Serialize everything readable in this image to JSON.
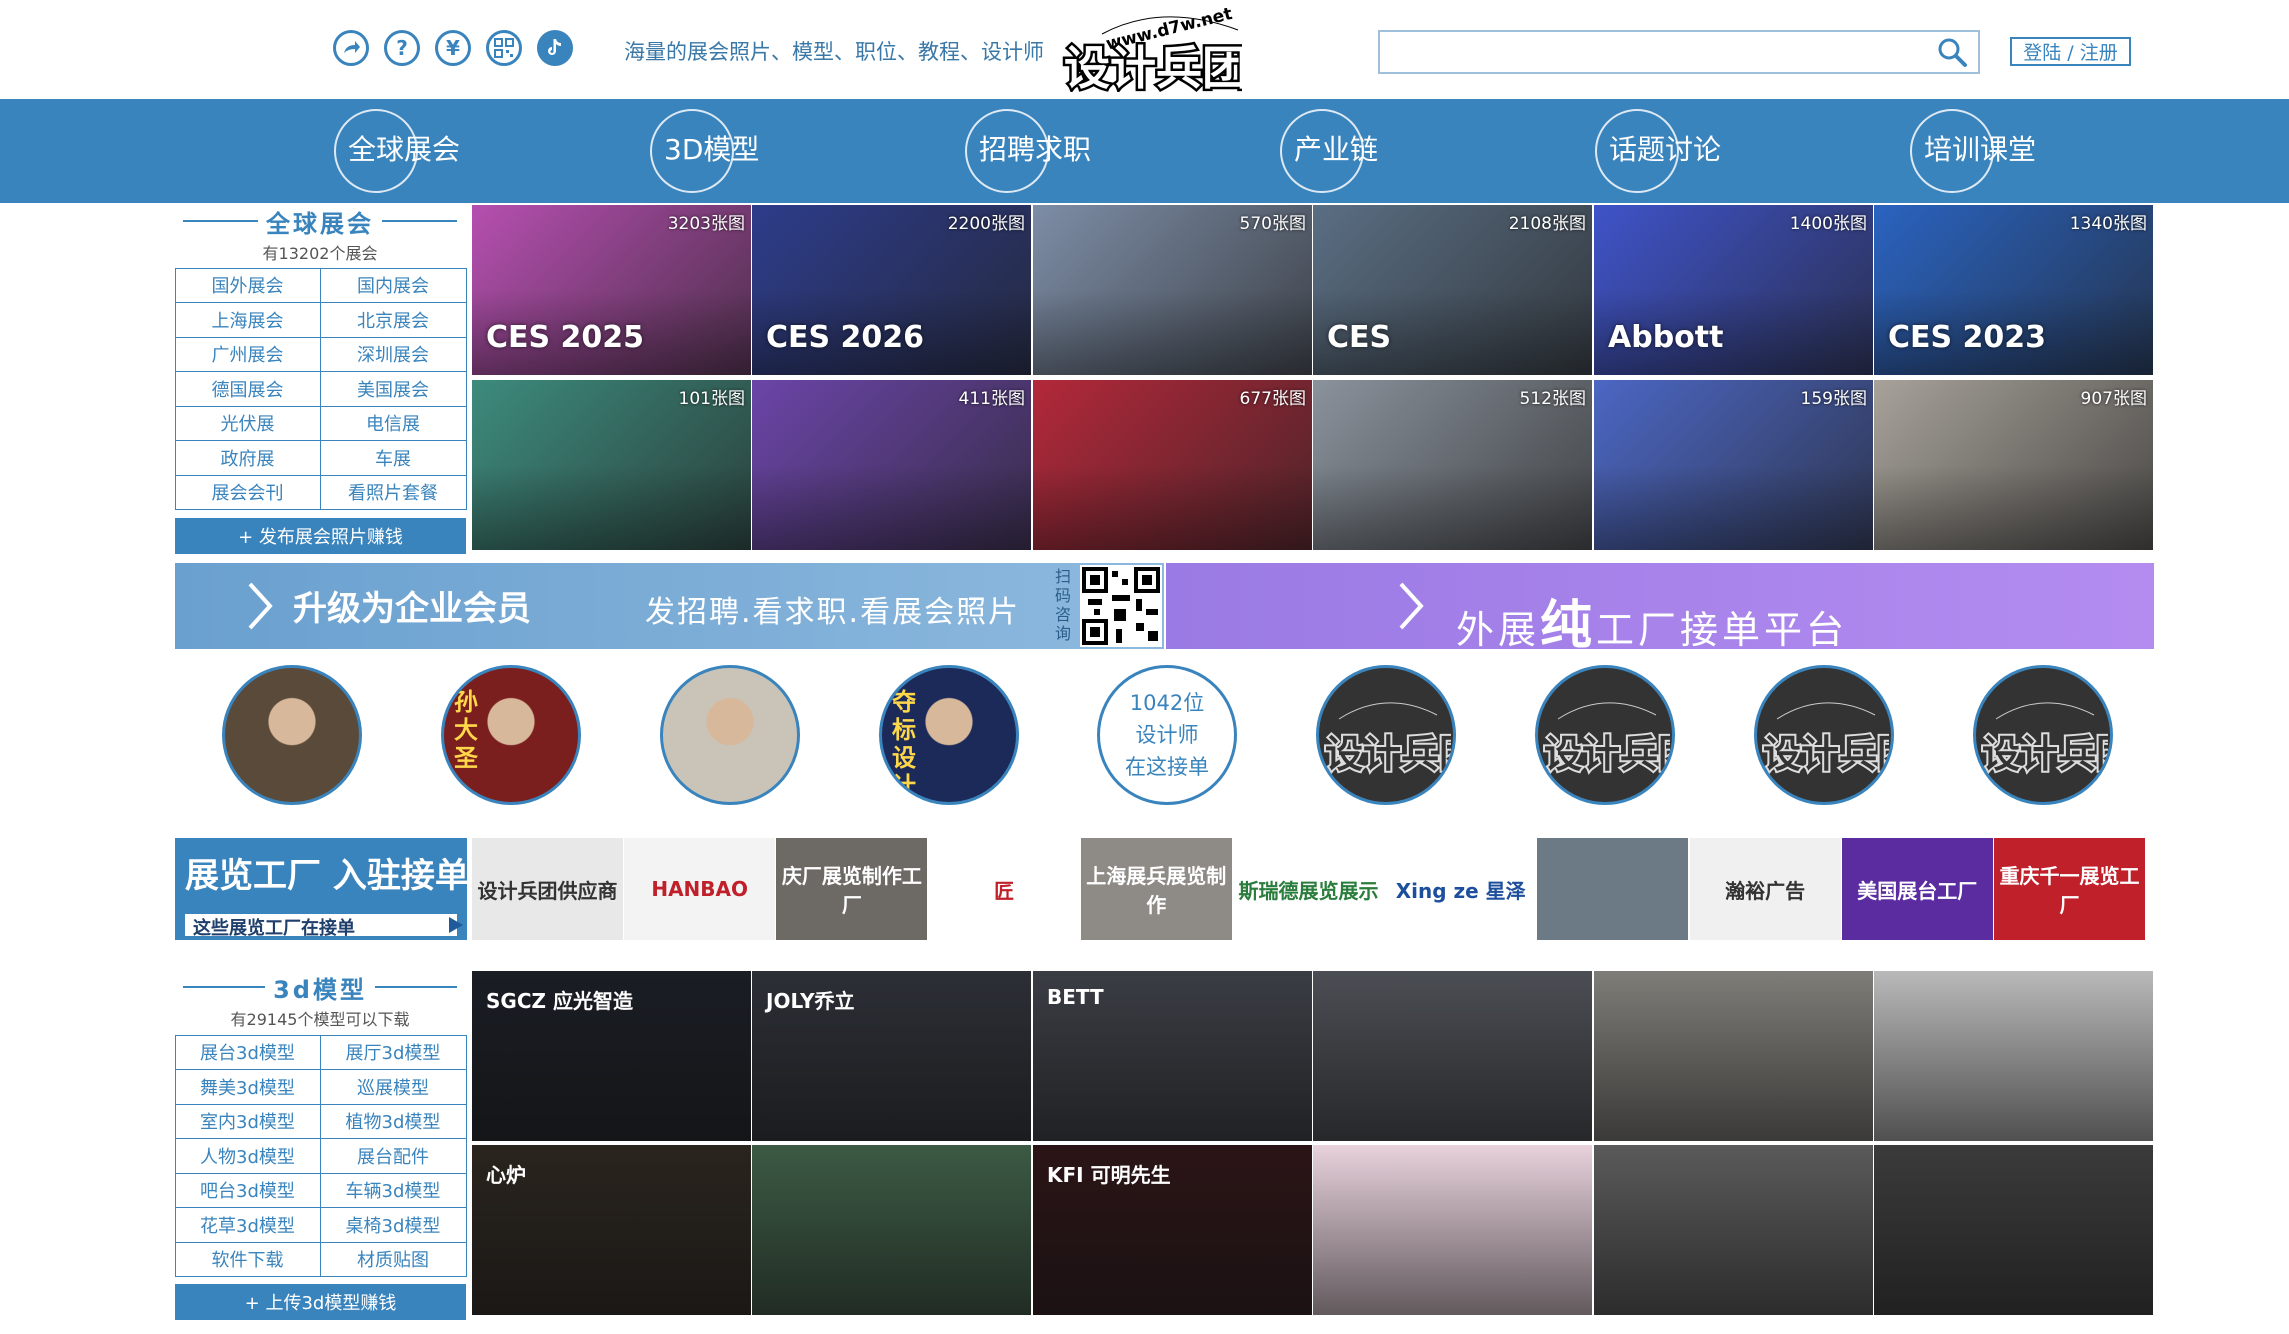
{
  "header": {
    "icons": [
      "share-icon",
      "help-icon",
      "yen-icon",
      "qrcode-icon",
      "douyin-icon"
    ],
    "slogan": "海量的展会照片、模型、职位、教程、设计师",
    "logo_text": "www.d7w.net",
    "logo_mark": "设计兵团",
    "search": {
      "value": "",
      "placeholder": ""
    },
    "login_label": "登陆 / 注册"
  },
  "nav": {
    "items": [
      {
        "label": "全球展会"
      },
      {
        "label": "3D模型"
      },
      {
        "label": "招聘求职"
      },
      {
        "label": "产业链"
      },
      {
        "label": "话题讨论"
      },
      {
        "label": "培训课堂"
      }
    ]
  },
  "expo": {
    "title": "全球展会",
    "subtitle": "有13202个展会",
    "links": [
      "国外展会",
      "国内展会",
      "上海展会",
      "北京展会",
      "广州展会",
      "深圳展会",
      "德国展会",
      "美国展会",
      "光伏展",
      "电信展",
      "政府展",
      "车展",
      "展会会刊",
      "看照片套餐"
    ],
    "action": "+ 发布展会照片赚钱",
    "photos": [
      {
        "count": "3203张图",
        "caption": "CES 2025",
        "color": "#b64fb0"
      },
      {
        "count": "2200张图",
        "caption": "CES 2026",
        "color": "#2d3c8a"
      },
      {
        "count": "570张图",
        "caption": "",
        "color": "#7d8da6"
      },
      {
        "count": "2108张图",
        "caption": "CES",
        "color": "#5a6e83"
      },
      {
        "count": "1400张图",
        "caption": "Abbott",
        "color": "#3f53c9"
      },
      {
        "count": "1340张图",
        "caption": "CES 2023",
        "color": "#2a63c0"
      },
      {
        "count": "101张图",
        "caption": "",
        "color": "#3d8b7d"
      },
      {
        "count": "411张图",
        "caption": "",
        "color": "#6b45a8"
      },
      {
        "count": "677张图",
        "caption": "",
        "color": "#b3283a"
      },
      {
        "count": "512张图",
        "caption": "",
        "color": "#8a929c"
      },
      {
        "count": "159张图",
        "caption": "",
        "color": "#4c67c4"
      },
      {
        "count": "907张图",
        "caption": "",
        "color": "#a7a29a"
      }
    ]
  },
  "banners": {
    "member": {
      "main": "升级为企业会员",
      "sub": "发招聘.看求职.看展会照片",
      "scan": "扫码咨询"
    },
    "factory": {
      "prefix": "外展",
      "bold": "纯",
      "suffix": "工厂接单平台"
    }
  },
  "designers": {
    "avatars": [
      {
        "name": "",
        "color": "#5a4a3a"
      },
      {
        "name": "孙大圣",
        "color": "#7a1e1e"
      },
      {
        "name": "",
        "color": "#c9c3b8"
      },
      {
        "name": "夺标设计",
        "color": "#1c2a5a"
      }
    ],
    "count_lines": [
      "1042位",
      "设计师",
      "在这接单"
    ],
    "logo_count": 4
  },
  "factories": {
    "ad_title": "展览工厂 入驻接单",
    "ad_sub": "这些展览工厂在接单",
    "logos": [
      {
        "text": "设计兵团供应商",
        "bg": "#e8e8e8",
        "fg": "#333"
      },
      {
        "text": "HANBAO",
        "bg": "#f3f3f3",
        "fg": "#c0202a"
      },
      {
        "text": "庆厂展览制作工厂",
        "bg": "#6d6a66",
        "fg": "#fff"
      },
      {
        "text": "匠",
        "bg": "#ffffff",
        "fg": "#c0202a"
      },
      {
        "text": "上海展兵展览制作",
        "bg": "#8e8b86",
        "fg": "#fff"
      },
      {
        "text": "斯瑞德展览展示",
        "bg": "#ffffff",
        "fg": "#2a7d3c"
      },
      {
        "text": "Xing ze 星泽",
        "bg": "#ffffff",
        "fg": "#1e4f9c"
      },
      {
        "text": "",
        "bg": "#6c7a86",
        "fg": "#fff"
      },
      {
        "text": "瀚裕广告",
        "bg": "#f0f0f0",
        "fg": "#333"
      },
      {
        "text": "美国展台工厂",
        "bg": "#5a2ca0",
        "fg": "#fff"
      },
      {
        "text": "重庆千一展览工厂",
        "bg": "#c0202a",
        "fg": "#fff"
      }
    ]
  },
  "models": {
    "title": "3d模型",
    "subtitle": "有29145个模型可以下载",
    "links": [
      "展台3d模型",
      "展厅3d模型",
      "舞美3d模型",
      "巡展模型",
      "室内3d模型",
      "植物3d模型",
      "人物3d模型",
      "展台配件",
      "吧台3d模型",
      "车辆3d模型",
      "花草3d模型",
      "桌椅3d模型",
      "软件下载",
      "材质贴图"
    ],
    "action": "+ 上传3d模型赚钱",
    "tiles": [
      {
        "caption": "SGCZ 应光智造",
        "color": "#1a1d24"
      },
      {
        "caption": "JOLY乔立",
        "color": "#2c2f36"
      },
      {
        "caption": "BETT",
        "color": "#3a3d44"
      },
      {
        "caption": "",
        "color": "#4b4e54"
      },
      {
        "caption": "",
        "color": "#7e7d78"
      },
      {
        "caption": "",
        "color": "#b9b9b9"
      },
      {
        "caption": "心炉",
        "color": "#2a241e"
      },
      {
        "caption": "",
        "color": "#3c5a44"
      },
      {
        "caption": "KFI 可明先生",
        "color": "#2b1416"
      },
      {
        "caption": "",
        "color": "#e8d2dc"
      },
      {
        "caption": "",
        "color": "#5a5a5a"
      },
      {
        "caption": "",
        "color": "#3b3b3b"
      }
    ]
  },
  "colors": {
    "brand": "#3a84bd",
    "purple": "#a47ceb"
  }
}
